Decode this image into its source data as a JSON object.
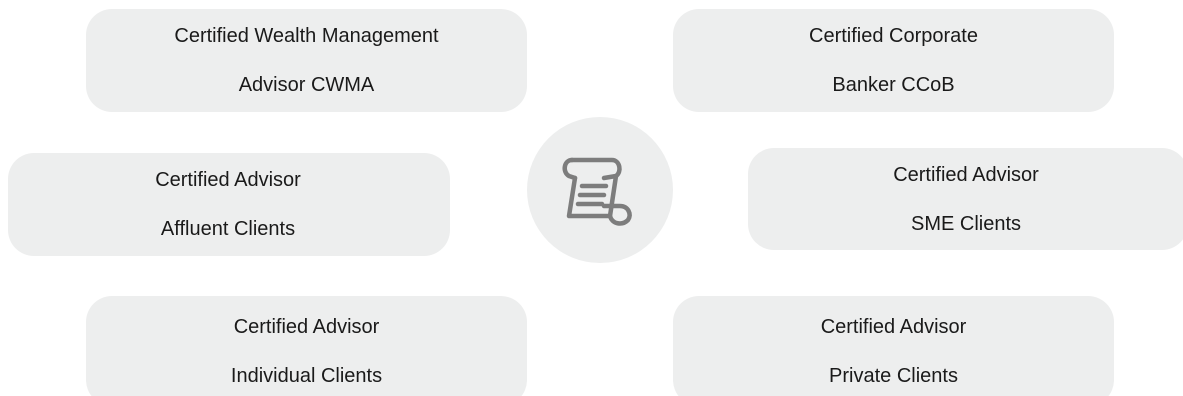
{
  "cards": {
    "cwma": {
      "line1": "Certified Wealth Management",
      "line2": "Advisor CWMA"
    },
    "ccob": {
      "line1": "Certified Corporate",
      "line2": "Banker CCoB"
    },
    "affluent": {
      "line1": "Certified Advisor",
      "line2": "Affluent Clients"
    },
    "sme": {
      "line1": "Certified Advisor",
      "line2": "SME Clients"
    },
    "individual": {
      "line1": "Certified Advisor",
      "line2": "Individual Clients"
    },
    "private": {
      "line1": "Certified Advisor",
      "line2": "Private Clients"
    }
  },
  "center": {
    "icon": "scroll-icon"
  },
  "colors": {
    "card_bg": "#edeeee",
    "icon_stroke": "#7d7d7d",
    "text": "#1a1a1a"
  }
}
